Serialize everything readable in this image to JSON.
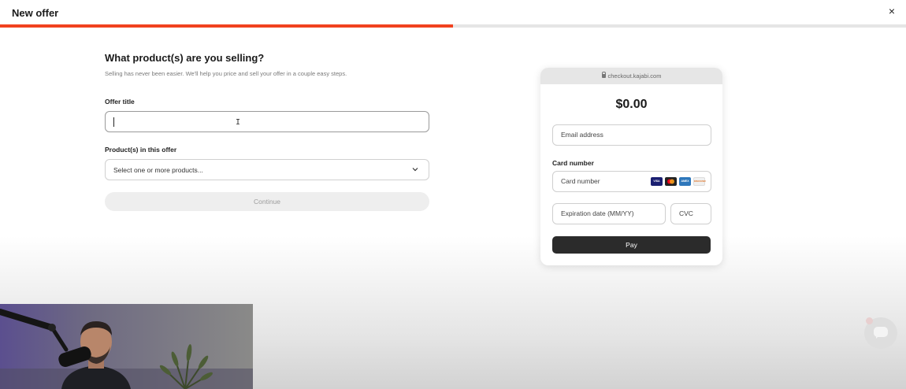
{
  "header": {
    "title": "New offer",
    "close_icon": "close-icon",
    "close_glyph": "×"
  },
  "progress": {
    "fraction": 0.5,
    "color": "#f1421f"
  },
  "form": {
    "heading": "What product(s) are you selling?",
    "subtitle": "Selling has never been easier. We'll help you price and sell your offer in a couple easy steps.",
    "offer_title_label": "Offer title",
    "offer_title_value": "",
    "products_label": "Product(s) in this offer",
    "products_placeholder": "Select one or more products...",
    "continue_label": "Continue"
  },
  "checkout": {
    "url": "checkout.kajabi.com",
    "price": "$0.00",
    "email_placeholder": "Email address",
    "card_section_label": "Card number",
    "card_placeholder": "Card number",
    "card_brands": [
      {
        "name": "VISA",
        "color": "#1a1f71"
      },
      {
        "name": "MC",
        "color": "#222222"
      },
      {
        "name": "AMEX",
        "color": "#2e77bb"
      },
      {
        "name": "DISCOVER",
        "color": "#f0f0f0"
      }
    ],
    "expiry_placeholder": "Expiration date (MM/YY)",
    "cvc_placeholder": "CVC",
    "pay_label": "Pay"
  },
  "colors": {
    "accent": "#f1421f",
    "pay_button": "#2b2b2b"
  }
}
